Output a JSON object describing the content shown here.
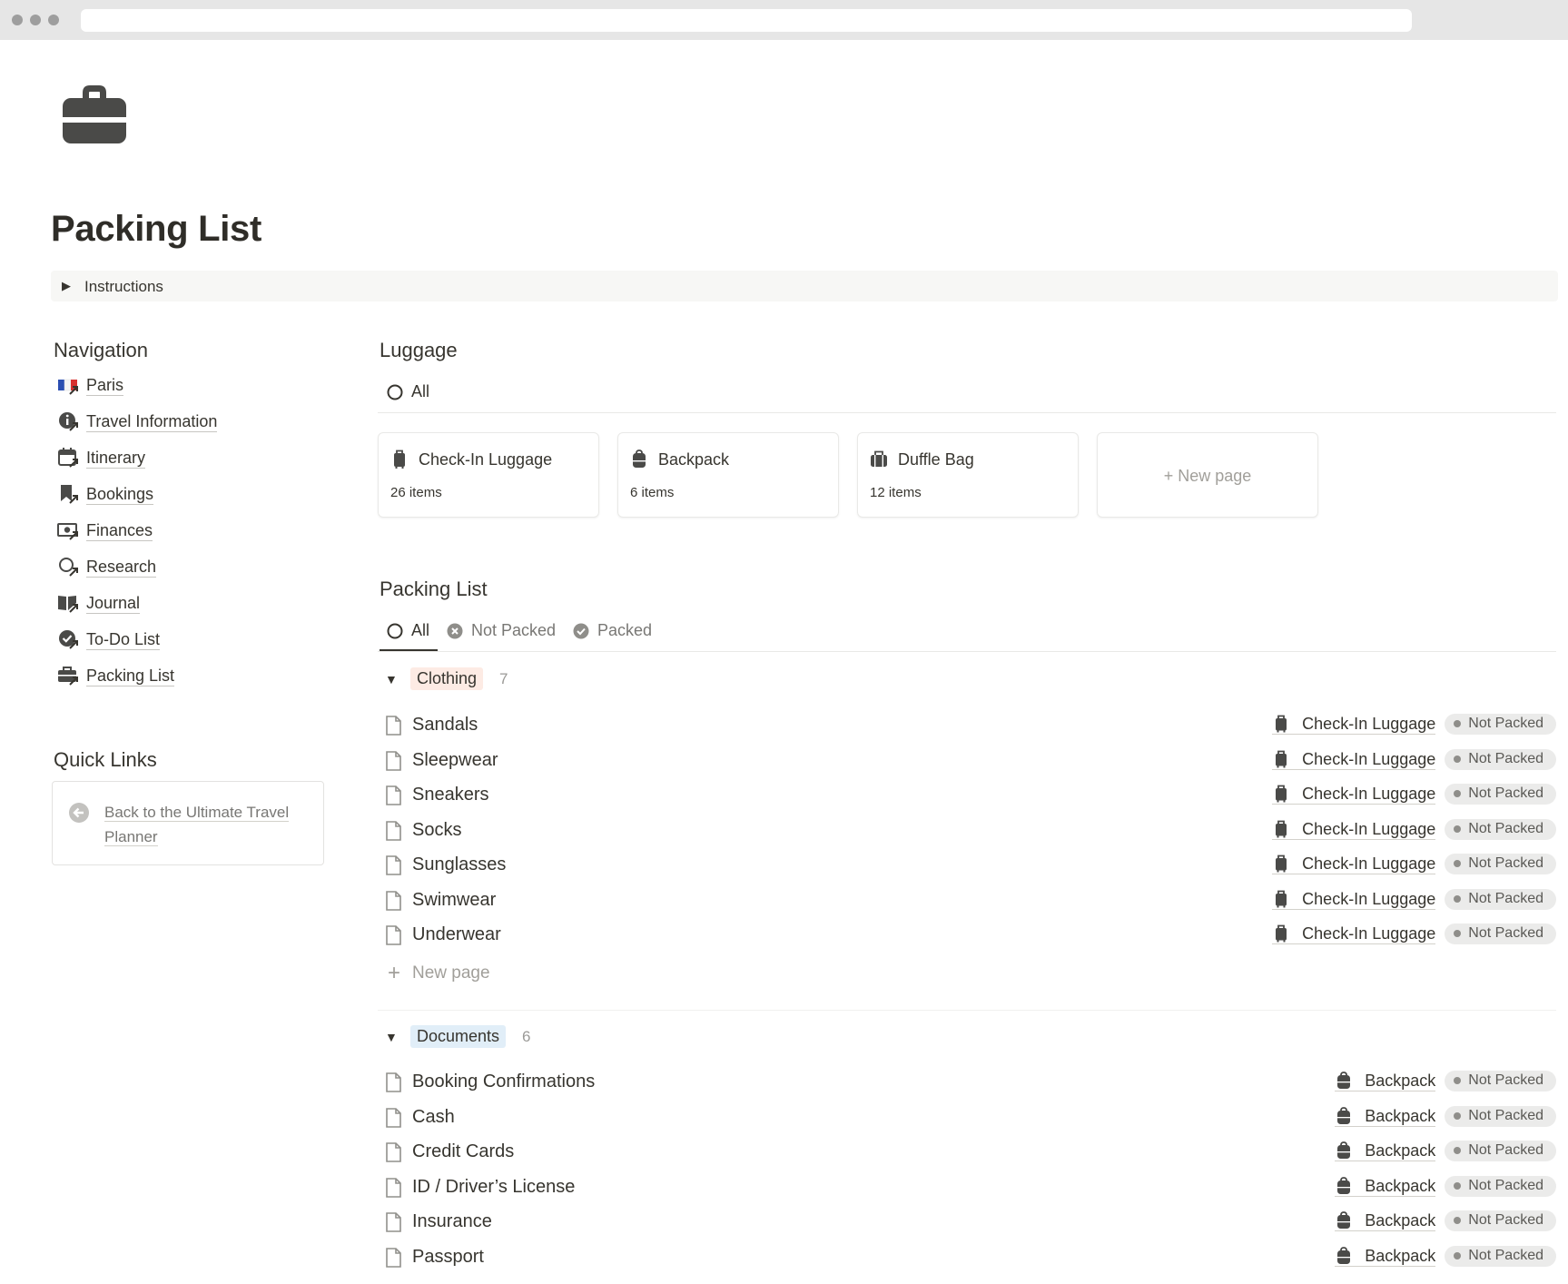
{
  "page": {
    "title": "Packing List",
    "icon": "briefcase-icon"
  },
  "instructions": {
    "label": "Instructions"
  },
  "navigation": {
    "heading": "Navigation",
    "items": [
      {
        "label": "Paris",
        "icon": "france-flag-icon"
      },
      {
        "label": "Travel Information",
        "icon": "info-icon"
      },
      {
        "label": "Itinerary",
        "icon": "calendar-icon"
      },
      {
        "label": "Bookings",
        "icon": "bookmark-icon"
      },
      {
        "label": "Finances",
        "icon": "money-icon"
      },
      {
        "label": "Research",
        "icon": "magnifier-icon"
      },
      {
        "label": "Journal",
        "icon": "book-icon"
      },
      {
        "label": "To-Do List",
        "icon": "check-circle-icon"
      },
      {
        "label": "Packing List",
        "icon": "briefcase-icon"
      }
    ]
  },
  "quick_links": {
    "heading": "Quick Links",
    "items": [
      {
        "label": "Back to the Ultimate Travel Planner",
        "icon": "arrow-left-circle-icon"
      }
    ]
  },
  "luggage": {
    "heading": "Luggage",
    "tabs": [
      {
        "label": "All"
      }
    ],
    "cards": [
      {
        "title": "Check-In Luggage",
        "count": "26 items",
        "icon": "suitcase-icon"
      },
      {
        "title": "Backpack",
        "count": "6 items",
        "icon": "backpack-icon"
      },
      {
        "title": "Duffle Bag",
        "count": "12 items",
        "icon": "duffle-bag-icon"
      }
    ],
    "new_page": "New page"
  },
  "packing_list": {
    "heading": "Packing List",
    "tabs": [
      {
        "label": "All"
      },
      {
        "label": "Not Packed"
      },
      {
        "label": "Packed"
      }
    ],
    "groups": [
      {
        "name": "Clothing",
        "count": "7",
        "color": "#fdebe4",
        "rows": [
          {
            "name": "Sandals",
            "luggage": "Check-In Luggage",
            "status": "Not Packed"
          },
          {
            "name": "Sleepwear",
            "luggage": "Check-In Luggage",
            "status": "Not Packed"
          },
          {
            "name": "Sneakers",
            "luggage": "Check-In Luggage",
            "status": "Not Packed"
          },
          {
            "name": "Socks",
            "luggage": "Check-In Luggage",
            "status": "Not Packed"
          },
          {
            "name": "Sunglasses",
            "luggage": "Check-In Luggage",
            "status": "Not Packed"
          },
          {
            "name": "Swimwear",
            "luggage": "Check-In Luggage",
            "status": "Not Packed"
          },
          {
            "name": "Underwear",
            "luggage": "Check-In Luggage",
            "status": "Not Packed"
          }
        ],
        "new_page": "New page"
      },
      {
        "name": "Documents",
        "count": "6",
        "color": "#e1eef8",
        "rows": [
          {
            "name": "Booking Confirmations",
            "luggage": "Backpack",
            "status": "Not Packed"
          },
          {
            "name": "Cash",
            "luggage": "Backpack",
            "status": "Not Packed"
          },
          {
            "name": "Credit Cards",
            "luggage": "Backpack",
            "status": "Not Packed"
          },
          {
            "name": "ID / Driver’s License",
            "luggage": "Backpack",
            "status": "Not Packed"
          },
          {
            "name": "Insurance",
            "luggage": "Backpack",
            "status": "Not Packed"
          },
          {
            "name": "Passport",
            "luggage": "Backpack",
            "status": "Not Packed"
          }
        ]
      }
    ]
  }
}
